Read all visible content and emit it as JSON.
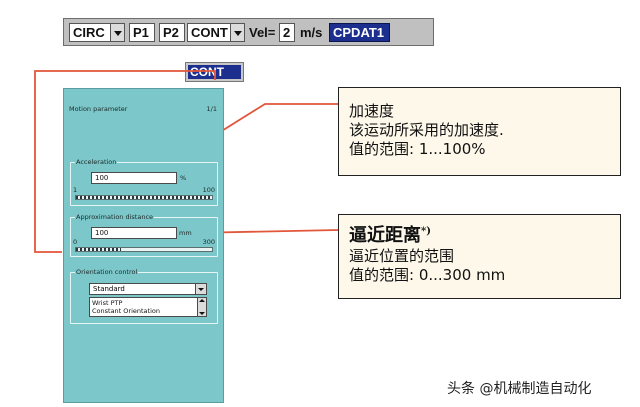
{
  "command_bar": {
    "motion_type": "CIRC",
    "point1": "P1",
    "point2": "P2",
    "approx_mode": "CONT",
    "vel_label": "Vel=",
    "vel_value": "2",
    "vel_unit": "m/s",
    "data_set": "CPDAT1"
  },
  "cont_dropdown": {
    "items": [
      "CONT"
    ]
  },
  "panel": {
    "title": "Motion parameter",
    "page": "1/1",
    "acceleration": {
      "label": "Acceleration",
      "value": "100",
      "unit": "%",
      "min": "1",
      "max": "100",
      "fill_fraction": 1.0
    },
    "approximation": {
      "label": "Approximation distance",
      "value": "100",
      "unit": "mm",
      "min": "0",
      "max": "300",
      "fill_fraction": 0.33
    },
    "orientation": {
      "label": "Orientation control",
      "selected": "Standard",
      "options": [
        "Wrist PTP",
        "Constant Orientation"
      ]
    }
  },
  "callouts": {
    "accel": {
      "title": "加速度",
      "desc": "该运动所采用的加速度.",
      "range": "值的范围: 1...100%"
    },
    "approx": {
      "title": "逼近距离",
      "title_note": "*)",
      "desc": "逼近位置的范围",
      "range": "值的范围: 0...300 mm"
    }
  },
  "watermark": "头条 @机械制造自动化",
  "colors": {
    "panel_bg": "#7cc7c9",
    "selection": "#1c2f8e",
    "callout_bg": "#fdf8ea"
  }
}
